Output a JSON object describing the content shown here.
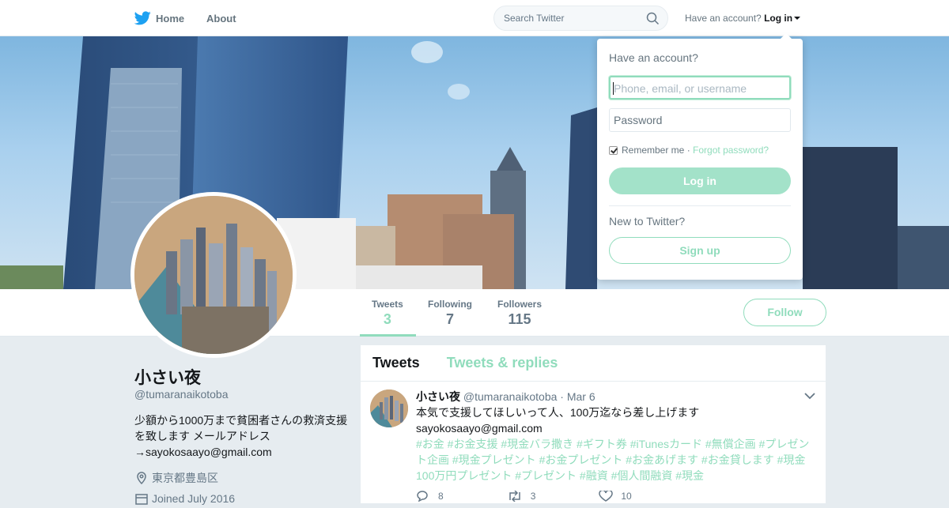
{
  "topnav": {
    "home_label": "Home",
    "about_label": "About",
    "search_placeholder": "Search Twitter",
    "account_prompt": "Have an account?",
    "login_label": "Log in"
  },
  "profile_nav": {
    "tweets_label": "Tweets",
    "tweets_count": "3",
    "following_label": "Following",
    "following_count": "7",
    "followers_label": "Followers",
    "followers_count": "115",
    "follow_button": "Follow"
  },
  "profile": {
    "name": "小さい夜",
    "handle": "@tumaranaikotoba",
    "bio": "少額から1000万まで貧困者さんの救済支援を致します メールアドレス→sayokosaayo@gmail.com",
    "location": "東京都豊島区",
    "joined": "Joined July 2016"
  },
  "timeline": {
    "tab_tweets": "Tweets",
    "tab_replies": "Tweets & replies",
    "tweet": {
      "name": "小さい夜",
      "handle": "@tumaranaikotoba",
      "date": "· Mar 6",
      "text_line1": "本気で支援してほしいって人、100万迄なら差し上げます",
      "text_line2": "sayokosaayo@gmail.com",
      "hashtags": "#お金 #お金支援 #現金バラ撒き #ギフト券 #iTunesカード #無償企画 #プレゼント企画 #現金プレゼント #お金プレゼント #お金あげます #お金貸します #現金100万円プレゼント #プレゼント #融資 #個人間融資 #現金",
      "replies": "8",
      "retweets": "3",
      "likes": "10"
    }
  },
  "login_dropdown": {
    "title": "Have an account?",
    "username_placeholder": "Phone, email, or username",
    "password_placeholder": "Password",
    "remember_label": "Remember me",
    "separator": "·",
    "forgot_label": "Forgot password?",
    "login_button": "Log in",
    "new_prompt": "New to Twitter?",
    "signup_button": "Sign up"
  },
  "colors": {
    "accent": "#90dcbc",
    "twitter_blue": "#1da1f2",
    "text": "#14171a",
    "muted": "#657786"
  }
}
